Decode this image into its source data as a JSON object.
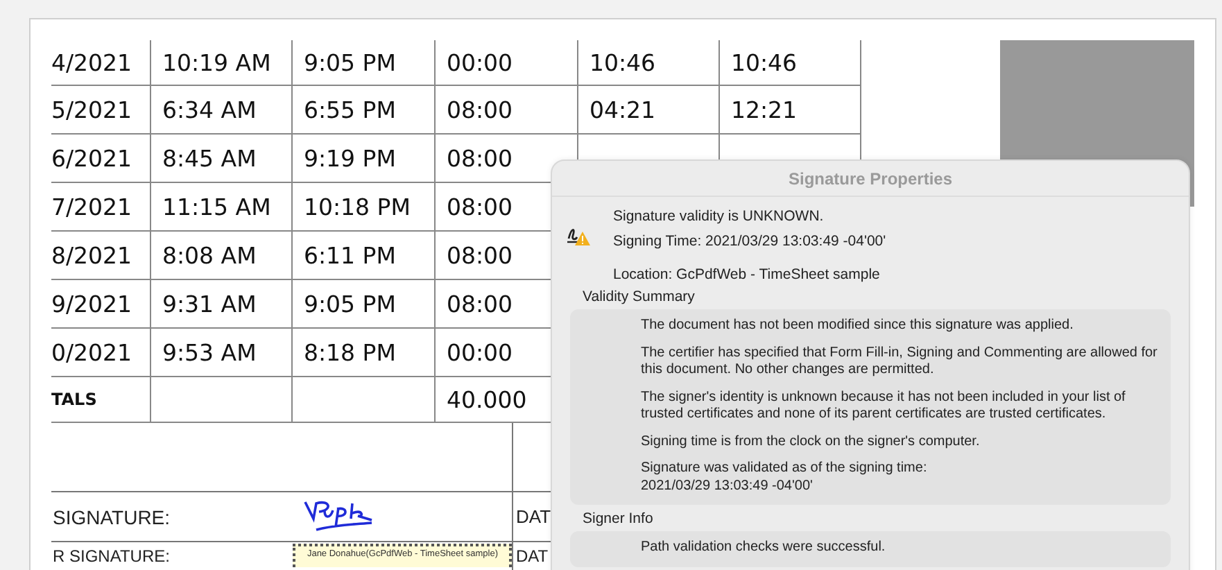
{
  "table": {
    "rows": [
      {
        "cells": [
          "4/2021",
          "10:19 AM",
          "9:05 PM",
          "00:00",
          "10:46",
          "10:46"
        ]
      },
      {
        "cells": [
          "5/2021",
          "6:34 AM",
          "6:55 PM",
          "08:00",
          "04:21",
          "12:21"
        ]
      },
      {
        "cells": [
          "6/2021",
          "8:45 AM",
          "9:19 PM",
          "08:00"
        ]
      },
      {
        "cells": [
          "7/2021",
          "11:15 AM",
          "10:18 PM",
          "08:00"
        ]
      },
      {
        "cells": [
          "8/2021",
          "8:08 AM",
          "6:11 PM",
          "08:00"
        ]
      },
      {
        "cells": [
          "9/2021",
          "9:31 AM",
          "9:05 PM",
          "08:00"
        ]
      },
      {
        "cells": [
          "0/2021",
          "9:53 AM",
          "8:18 PM",
          "00:00"
        ]
      }
    ],
    "totals": {
      "label": "TALS",
      "value": "40.000"
    }
  },
  "signatures": [
    {
      "kind": "handwritten",
      "label": "SIGNATURE:",
      "date_label": "DAT"
    },
    {
      "kind": "stamp",
      "label": "R SIGNATURE:",
      "date_label": "DAT",
      "stamp_text": "Jane Donahue(GcPdfWeb - TimeSheet sample)"
    }
  ],
  "dialog": {
    "title": "Signature Properties",
    "status": "Signature validity is UNKNOWN.",
    "signing_time": "Signing Time:  2021/03/29 13:03:49 -04'00'",
    "location": "Location:  GcPdfWeb - TimeSheet sample",
    "sections": [
      {
        "title": "Validity Summary",
        "paragraphs": [
          "The document has not been modified since this signature was applied.",
          "The certifier has specified that Form Fill-in, Signing and Commenting are allowed for this document. No other changes are permitted.",
          "The signer's identity is unknown because it has not been included in your list of trusted certificates and none of its parent certificates are trusted certificates.",
          "Signing time is from the clock on the signer's computer.",
          "Signature was validated as of the signing time:\n2021/03/29 13:03:49 -04'00'"
        ]
      },
      {
        "title": "Signer Info",
        "paragraphs": [
          "Path validation checks were successful."
        ]
      }
    ]
  }
}
